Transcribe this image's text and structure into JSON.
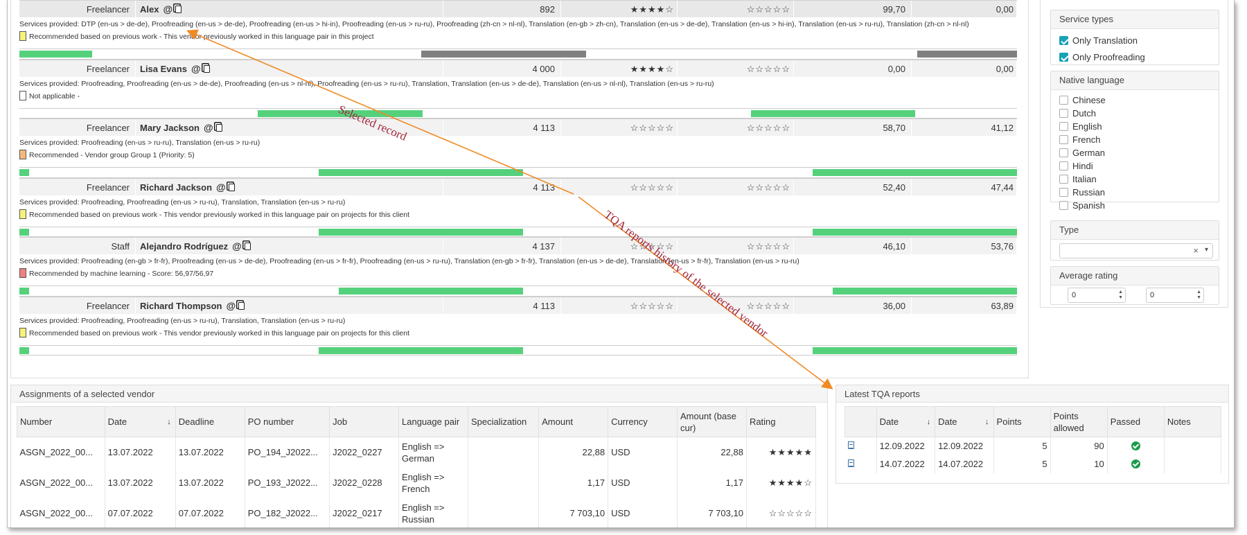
{
  "vendors": [
    {
      "type": "Freelancer",
      "name": "Alex",
      "count": "892",
      "rating1": "★★★★☆",
      "rating2": "☆☆☆☆☆",
      "val1": "99,70",
      "val2": "0,00",
      "services": "Services provided:  DTP (en-us > de-de), Proofreading (en-us > de-de), Proofreading (en-us > hi-in), Proofreading (en-us > ru-ru), Proofreading (zh-cn > nl-nl), Translation (en-gb > zh-cn), Translation (en-us > de-de), Translation (en-us > hi-in), Translation (en-us > ru-ru), Translation (zh-cn > nl-nl)",
      "recommendation": "Recommended based on previous work - This vendor previously worked in this language pair in this project",
      "swatch": "#f7f27a",
      "bars": [
        {
          "f": 0.0,
          "w": 0.073,
          "c": "#55d17c"
        },
        {
          "f": 0.403,
          "w": 0.165,
          "c": "#808080"
        },
        {
          "f": 0.9,
          "w": 0.1,
          "c": "#808080"
        }
      ]
    },
    {
      "type": "Freelancer",
      "name": "Lisa Evans",
      "count": "4 000",
      "rating1": "★★★★☆",
      "rating2": "☆☆☆☆☆",
      "val1": "0,00",
      "val2": "0,00",
      "services": "Services provided:  Proofreading, Proofreading (en-us > de-de), Proofreading (en-us > nl-nl), Proofreading (en-us > ru-ru), Translation, Translation (en-us > de-de), Translation (en-us > nl-nl), Translation (en-us > ru-ru)",
      "recommendation": "Not applicable -",
      "swatch": "#ffffff",
      "bars": [
        {
          "f": 0.239,
          "w": 0.165,
          "c": "#55d17c"
        },
        {
          "f": 0.733,
          "w": 0.165,
          "c": "#55d17c"
        }
      ]
    },
    {
      "type": "Freelancer",
      "name": "Mary Jackson",
      "count": "4 113",
      "rating1": "☆☆☆☆☆",
      "rating2": "☆☆☆☆☆",
      "val1": "58,70",
      "val2": "41,12",
      "services": "Services provided:  Proofreading (en-us > ru-ru), Translation (en-us > ru-ru)",
      "recommendation": "Recommended - Vendor group Group 1 (Priority: 5)",
      "swatch": "#f5b97a",
      "bars": [
        {
          "f": 0.0,
          "w": 0.01,
          "c": "#55d17c"
        },
        {
          "f": 0.3,
          "w": 0.205,
          "c": "#55d17c"
        },
        {
          "f": 0.795,
          "w": 0.205,
          "c": "#55d17c"
        }
      ]
    },
    {
      "type": "Freelancer",
      "name": "Richard Jackson",
      "count": "4 113",
      "rating1": "☆☆☆☆☆",
      "rating2": "☆☆☆☆☆",
      "val1": "52,40",
      "val2": "47,44",
      "services": "Services provided:  Proofreading, Proofreading (en-us > ru-ru), Translation, Translation (en-us > ru-ru)",
      "recommendation": "Recommended based on previous work - This vendor previously worked in this language pair on projects for this client",
      "swatch": "#f7f27a",
      "bars": [
        {
          "f": 0.0,
          "w": 0.01,
          "c": "#55d17c"
        },
        {
          "f": 0.3,
          "w": 0.205,
          "c": "#55d17c"
        },
        {
          "f": 0.795,
          "w": 0.205,
          "c": "#55d17c"
        }
      ]
    },
    {
      "type": "Staff",
      "name": "Alejandro Rodríguez",
      "count": "4 137",
      "rating1": "☆☆☆☆☆",
      "rating2": "☆☆☆☆☆",
      "val1": "46,10",
      "val2": "53,76",
      "services": "Services provided:  Proofreading (en-gb > fr-fr), Proofreading (en-us > de-de), Proofreading (en-us > fr-fr), Proofreading (en-us > ru-ru), Translation (en-gb > fr-fr), Translation (en-us > de-de), Translation (en-us > fr-fr), Translation (en-us > ru-ru)",
      "recommendation": "Recommended by machine learning - Score: 56,97/56,97",
      "swatch": "#f08080",
      "bars": [
        {
          "f": 0.0,
          "w": 0.01,
          "c": "#55d17c"
        },
        {
          "f": 0.32,
          "w": 0.185,
          "c": "#55d17c"
        },
        {
          "f": 0.815,
          "w": 0.185,
          "c": "#55d17c"
        }
      ]
    },
    {
      "type": "Freelancer",
      "name": "Richard Thompson",
      "count": "4 113",
      "rating1": "☆☆☆☆☆",
      "rating2": "☆☆☆☆☆",
      "val1": "36,00",
      "val2": "63,89",
      "services": "Services provided:  Proofreading, Proofreading (en-us > ru-ru), Translation, Translation (en-us > ru-ru)",
      "recommendation": "Recommended based on previous work - This vendor previously worked in this language pair on projects for this client",
      "swatch": "#f7f27a",
      "bars": [
        {
          "f": 0.0,
          "w": 0.01,
          "c": "#55d17c"
        },
        {
          "f": 0.3,
          "w": 0.205,
          "c": "#55d17c"
        },
        {
          "f": 0.795,
          "w": 0.205,
          "c": "#55d17c"
        }
      ]
    }
  ],
  "annotations": {
    "selected": "Selected record",
    "history": "TQA reports history of the selected vendor"
  },
  "filters": {
    "service_types": {
      "title": "Service types",
      "items": [
        {
          "label": "Only Translation",
          "checked": true
        },
        {
          "label": "Only Proofreading",
          "checked": true
        }
      ]
    },
    "native_language": {
      "title": "Native language",
      "items": [
        "Chinese",
        "Dutch",
        "English",
        "French",
        "German",
        "Hindi",
        "Italian",
        "Russian",
        "Spanish"
      ]
    },
    "type": {
      "title": "Type",
      "clear": "×",
      "caret": "▾"
    },
    "average_rating": {
      "title": "Average rating",
      "min": "0",
      "max": "0"
    }
  },
  "assignments": {
    "title": "Assignments of a selected vendor",
    "columns": [
      "Number",
      "Date",
      "Deadline",
      "PO number",
      "Job",
      "Language pair",
      "Specialization",
      "Amount",
      "Currency",
      "Amount (base cur)",
      "Rating"
    ],
    "sort_icon": "↓",
    "rows": [
      [
        "ASGN_2022_00...",
        "13.07.2022",
        "13.07.2022",
        "PO_194_J2022...",
        "J2022_0227",
        "English => German",
        "",
        "22,88",
        "USD",
        "22,88",
        "★★★★★"
      ],
      [
        "ASGN_2022_00...",
        "13.07.2022",
        "13.07.2022",
        "PO_193_J2022...",
        "J2022_0228",
        "English => French",
        "",
        "1,17",
        "USD",
        "1,17",
        "★★★★☆"
      ],
      [
        "ASGN_2022_00...",
        "07.07.2022",
        "07.07.2022",
        "PO_182_J2022...",
        "J2022_0217",
        "English => Russian",
        "",
        "7 703,10",
        "USD",
        "7 703,10",
        "☆☆☆☆☆"
      ]
    ]
  },
  "tqa": {
    "title": "Latest TQA reports",
    "columns": [
      "",
      "Date",
      "Date",
      "Points",
      "Points allowed",
      "Passed",
      "Notes"
    ],
    "sort_icon": "↓",
    "rows": [
      [
        "doc-icon",
        "12.09.2022",
        "12.09.2022",
        "5",
        "90",
        "passed",
        ""
      ],
      [
        "doc-icon",
        "14.07.2022",
        "14.07.2022",
        "5",
        "10",
        "passed",
        ""
      ]
    ]
  }
}
